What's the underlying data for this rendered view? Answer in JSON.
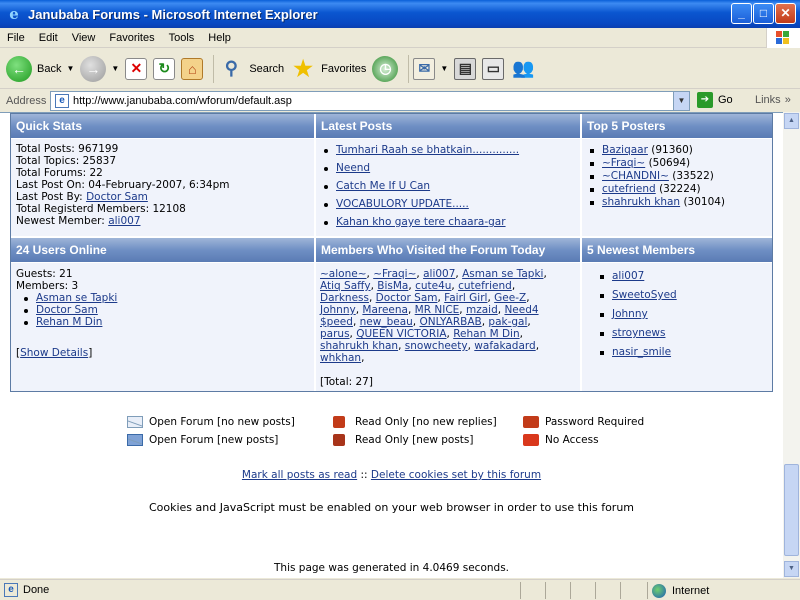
{
  "window": {
    "title": "Janubaba Forums - Microsoft Internet Explorer"
  },
  "menu": [
    "File",
    "Edit",
    "View",
    "Favorites",
    "Tools",
    "Help"
  ],
  "toolbar": {
    "back": "Back",
    "search": "Search",
    "favorites": "Favorites"
  },
  "address": {
    "label": "Address",
    "url": "http://www.janubaba.com/wforum/default.asp",
    "go": "Go",
    "links": "Links"
  },
  "quick_stats": {
    "header": "Quick Stats",
    "lines": [
      "Total Posts: 967199",
      "Total Topics: 25837",
      "Total Forums: 22",
      "Last Post On: 04-February-2007, 6:34pm"
    ],
    "last_post_by_label": "Last Post By:",
    "last_post_by": "Doctor Sam",
    "total_members": "Total Registerd Members: 12108",
    "newest_member_label": "Newest Member:",
    "newest_member": "ali007"
  },
  "latest_posts": {
    "header": "Latest Posts",
    "items": [
      "Tumhari Raah se bhatkain..............",
      "Neend",
      "Catch Me If U Can",
      "VOCABULORY UPDATE.....",
      "Kahan kho gaye tere chaara-gar"
    ]
  },
  "top_posters": {
    "header": "Top 5 Posters",
    "items": [
      {
        "name": "Baziqaar",
        "count": "(91360)"
      },
      {
        "name": "~Fraqi~",
        "count": "(50694)"
      },
      {
        "name": "~CHANDNI~",
        "count": "(33522)"
      },
      {
        "name": "cutefriend",
        "count": "(32224)"
      },
      {
        "name": "shahrukh khan",
        "count": "(30104)"
      }
    ]
  },
  "users_online": {
    "header": "24 Users Online",
    "guests": "Guests: 21",
    "members": "Members: 3",
    "list": [
      "Asman se Tapki",
      "Doctor Sam",
      "Rehan M Din"
    ],
    "show_details": "Show Details"
  },
  "visited_today": {
    "header": "Members Who Visited the Forum Today",
    "lines": [
      [
        "~alone~",
        "~Fraqi~",
        "ali007",
        "Asman se Tapki"
      ],
      [
        "Atiq Saffy",
        "BisMa",
        "cute4u",
        "cutefriend"
      ],
      [
        "Darkness",
        "Doctor Sam",
        "Fairl Girl",
        "Gee-Z"
      ],
      [
        "Johnny",
        "Mareena",
        "MR NICE",
        "mzaid",
        "Need4"
      ],
      [
        "$peed",
        "new_beau",
        "ONLYARBAB",
        "pak-gal"
      ],
      [
        "parus",
        "QUEEN VICTORIA",
        "Rehan M Din"
      ],
      [
        "shahrukh khan",
        "snowcheety",
        "wafakadard"
      ],
      [
        "whkhan"
      ]
    ],
    "total": "[Total: 27]"
  },
  "newest_members": {
    "header": "5 Newest Members",
    "items": [
      "ali007",
      "SweetoSyed",
      "Johnny",
      "stroynews",
      "nasir_smile"
    ]
  },
  "legend": {
    "open_no_new": "Open Forum [no new posts]",
    "open_new": "Open Forum [new posts]",
    "ro_no_new": "Read Only [no new replies]",
    "ro_new": "Read Only [new posts]",
    "password": "Password Required",
    "no_access": "No Access"
  },
  "footer": {
    "mark_all": "Mark all posts as read",
    "sep": "::",
    "delete_cookies": "Delete cookies set by this forum",
    "cookies_note": "Cookies and JavaScript must be enabled on your web browser in order to use this forum",
    "generated": "This page was generated in 4.0469 seconds."
  },
  "status": {
    "done": "Done",
    "zone": "Internet"
  }
}
